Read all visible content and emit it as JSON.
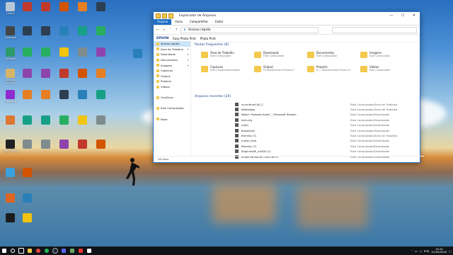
{
  "desktop_icons": [
    {
      "label": "Lixeira",
      "color": "#b9c7d6"
    },
    {
      "label": "Inkscape",
      "color": "#444"
    },
    {
      "label": "FxSound",
      "color": "#2d9a6b"
    },
    {
      "label": "Genshin Impact",
      "color": "#d8b46a"
    },
    {
      "label": "Lightshot",
      "color": "#8f2bd0"
    },
    {
      "label": "",
      "color": "#d73"
    },
    {
      "label": "Epic Games",
      "color": "#222"
    },
    {
      "label": "",
      "color": "#3aa0e0"
    },
    {
      "label": "",
      "color": "#d62"
    },
    {
      "label": "",
      "color": "#1b1b1b"
    }
  ],
  "explorer": {
    "title": "Explorador de Arquivos",
    "ribbon_tabs": [
      "Arquivo",
      "Início",
      "Compartilhar",
      "Exibir"
    ],
    "address": "Acesso rápido",
    "epson_brand": "EPSON",
    "epson_tool": "Easy Photo Print",
    "photo_print": "Photo Print",
    "nav": [
      {
        "label": "Acesso rápido",
        "pin": false,
        "sel": true
      },
      {
        "label": "Área de Trabalho",
        "pin": true,
        "sel": false
      },
      {
        "label": "Downloads",
        "pin": true,
        "sel": false
      },
      {
        "label": "Documentos",
        "pin": true,
        "sel": false
      },
      {
        "label": "Imagens",
        "pin": true,
        "sel": false
      },
      {
        "label": "Capturas",
        "pin": false,
        "sel": false
      },
      {
        "label": "Output",
        "pin": false,
        "sel": false
      },
      {
        "label": "Projects",
        "pin": false,
        "sel": false
      },
      {
        "label": "Vídeos",
        "pin": false,
        "sel": false
      },
      {
        "label": "",
        "pin": false,
        "sel": false
      },
      {
        "label": "OneDrive",
        "pin": false,
        "sel": false
      },
      {
        "label": "",
        "pin": false,
        "sel": false
      },
      {
        "label": "Este Computador",
        "pin": false,
        "sel": false
      },
      {
        "label": "",
        "pin": false,
        "sel": false
      },
      {
        "label": "Rede",
        "pin": false,
        "sel": false
      }
    ],
    "frequent_header": "Pastas frequentes (8)",
    "frequent": [
      {
        "name": "Área de Trabalho",
        "sub": "Este Computador"
      },
      {
        "name": "Downloads",
        "sub": "Este Computador"
      },
      {
        "name": "Documentos",
        "sub": "Este Computador"
      },
      {
        "name": "Imagens",
        "sub": "Este Computador"
      },
      {
        "name": "Capturas",
        "sub": "Este Computador\\Vídeos"
      },
      {
        "name": "Output",
        "sub": "E:\\Wondershare Filmora 9"
      },
      {
        "name": "Projects",
        "sub": "E:\\...\\Wondershare Filmora 9"
      },
      {
        "name": "Vídeos",
        "sub": "Este Computador"
      }
    ],
    "recent_header": "Arquivos recentes (20)",
    "recent": [
      {
        "name": "vcruntime140_1",
        "path": "Este Computador\\Área de Trabalho"
      },
      {
        "name": "WhatsApp",
        "path": "Este Computador\\Área de Trabalho"
      },
      {
        "name": "Watch 'Podcast Artes' _ Microsoft Stream",
        "path": "Este Computador\\Downloads"
      },
      {
        "name": "hsfx.cfg",
        "path": "Este Computador\\Downloads"
      },
      {
        "name": "mitm",
        "path": "Este Computador\\Downloads"
      },
      {
        "name": "blasehack",
        "path": "Este Computador\\Downloads"
      },
      {
        "name": "Eternity CC",
        "path": "Este Computador\\Área de Trabalho"
      },
      {
        "name": "mulan_free",
        "path": "Este Computador\\Downloads"
      },
      {
        "name": "Eternity CC",
        "path": "Este Computador\\Downloads"
      },
      {
        "name": "ShgininoSE_x4400 (1)",
        "path": "Este Computador\\Downloads"
      },
      {
        "name": "Script do BALÃO GÁSTRICO",
        "path": "Este Computador\\Downloads"
      }
    ],
    "status": "28 itens"
  },
  "taskbar": {
    "lang": "POR",
    "time": "19:32",
    "date": "01/09/2020"
  }
}
